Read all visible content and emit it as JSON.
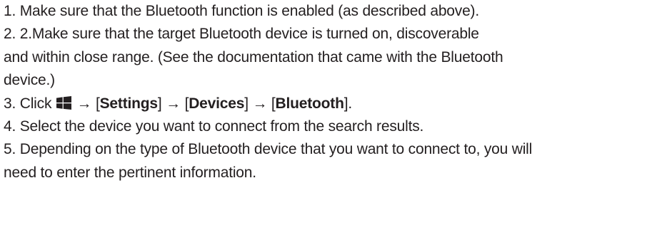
{
  "steps": {
    "s1": "1. Make sure that the Bluetooth function is enabled (as described above).",
    "s2_a": "2. 2.Make sure that the target Bluetooth device is turned on, discoverable",
    "s2_b": "and within close range. (See the documentation that came with the Bluetooth",
    "s2_c": "device.)",
    "s3": {
      "prefix": "3. Click ",
      "icon": "windows-logo-icon",
      "arrow1": " → [",
      "settings": "Settings",
      "arrow2": "] → [",
      "devices": "Devices",
      "arrow3": "] → [",
      "bluetooth": "Bluetooth",
      "suffix": "]."
    },
    "s4": "4. Select the device you want to connect from the search results.",
    "s5_a": "5. Depending on the type of Bluetooth device that you want to connect to, you will",
    "s5_b": "need to enter the pertinent information."
  },
  "colors": {
    "text": "#231f20",
    "icon": "#231f20"
  }
}
